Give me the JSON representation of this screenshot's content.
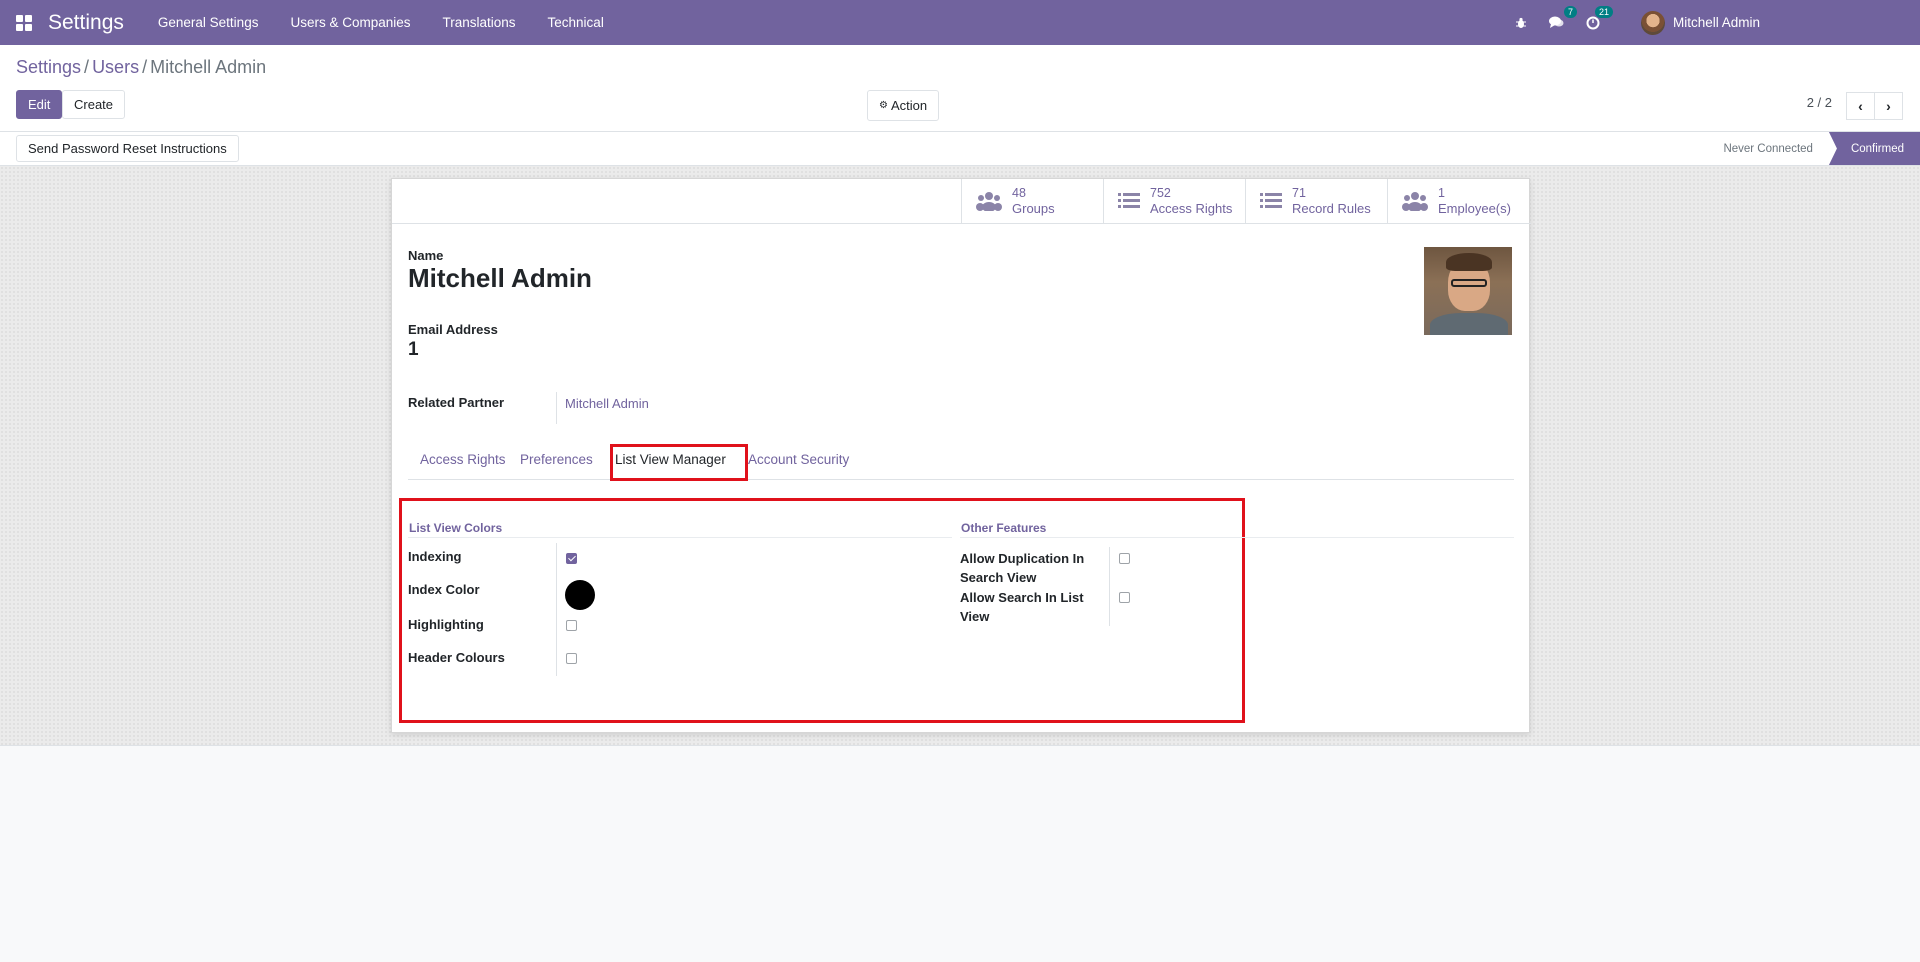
{
  "navbar": {
    "app_title": "Settings",
    "menu": [
      "General Settings",
      "Users & Companies",
      "Translations",
      "Technical"
    ],
    "messages_count": "7",
    "activities_count": "21",
    "user_name": "Mitchell Admin",
    "bg_color": "#71639e"
  },
  "breadcrumb": {
    "items": [
      "Settings",
      "Users"
    ],
    "current": "Mitchell Admin",
    "separator": "/"
  },
  "control_panel": {
    "edit_label": "Edit",
    "create_label": "Create",
    "action_label": "Action",
    "pager_text": "2 / 2"
  },
  "statusbar": {
    "reset_password_label": "Send Password Reset Instructions",
    "stages": [
      "Never Connected",
      "Confirmed"
    ],
    "active_stage": "Confirmed"
  },
  "smart_buttons": [
    {
      "value": "48",
      "label": "Groups",
      "icon": "users-icon"
    },
    {
      "value": "752",
      "label": "Access Rights",
      "icon": "list-icon"
    },
    {
      "value": "71",
      "label": "Record Rules",
      "icon": "list-icon"
    },
    {
      "value": "1",
      "label": "Employee(s)",
      "icon": "users-icon"
    }
  ],
  "form": {
    "name_label": "Name",
    "name_value": "Mitchell Admin",
    "email_label": "Email Address",
    "email_value": "1",
    "related_partner_label": "Related Partner",
    "related_partner_value": "Mitchell Admin"
  },
  "tabs": [
    "Access Rights",
    "Preferences",
    "List View Manager",
    "Account Security"
  ],
  "active_tab": "List View Manager",
  "list_view_colors": {
    "title": "List View Colors",
    "fields": [
      {
        "label": "Indexing",
        "type": "checkbox",
        "checked": true
      },
      {
        "label": "Index Color",
        "type": "color",
        "value": "#000000"
      },
      {
        "label": "Highlighting",
        "type": "checkbox",
        "checked": false
      },
      {
        "label": "Header Colours",
        "type": "checkbox",
        "checked": false
      }
    ]
  },
  "other_features": {
    "title": "Other Features",
    "fields": [
      {
        "label_line1": "Allow Duplication In",
        "label_line2": "Search View",
        "checked": false
      },
      {
        "label_line1": "Allow Search In List",
        "label_line2": "View",
        "checked": false
      }
    ]
  },
  "colors": {
    "accent": "#71639e",
    "highlight_border": "#e0111b"
  }
}
